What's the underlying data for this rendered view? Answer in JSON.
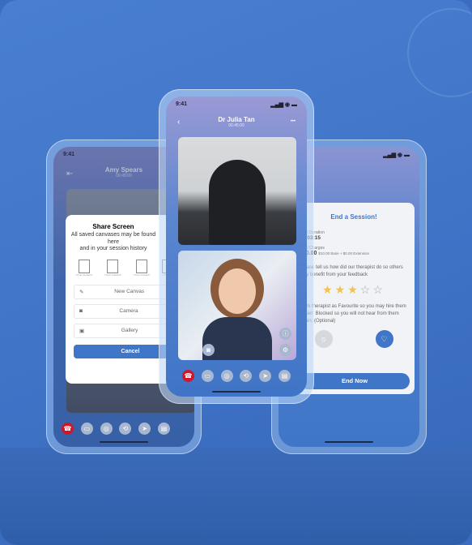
{
  "left_phone": {
    "time": "9:41",
    "name": "Amy Spears",
    "timer": "00:45:00",
    "modal": {
      "title": "Share Screen",
      "subtitle_line1": "All saved canvases may be found here",
      "subtitle_line2": "and in your session history",
      "files": [
        "<Time Created>",
        "<Time Created>",
        "<Time Created>",
        "<Time Cr..."
      ],
      "options": [
        {
          "label": "New Canvas",
          "icon": "edit-icon"
        },
        {
          "label": "Camera",
          "icon": "camera-icon"
        },
        {
          "label": "Gallery",
          "icon": "image-icon"
        }
      ],
      "cancel": "Cancel"
    }
  },
  "middle_phone": {
    "time": "9:41",
    "name": "Dr Julia Tan",
    "timer": "00:45:00",
    "back": "‹",
    "more": "•••"
  },
  "right_phone": {
    "card": {
      "title": "End a Session!",
      "duration_label": "Total Duration",
      "duration": "00:03:15",
      "charges_label": "Total Charges",
      "charges": "$10.00",
      "charges_detail": "$10.00 Base + $0.00 Extension",
      "feedback": "Please tell us how did our therapist do so others may benefit from your feedback",
      "rating": 3,
      "rating_max": 5,
      "favourite_text": "Mark therapist as Favourite so you may hire them easier; Blocked so you will not hear from them again. (Optional)",
      "end_button": "End Now"
    }
  }
}
